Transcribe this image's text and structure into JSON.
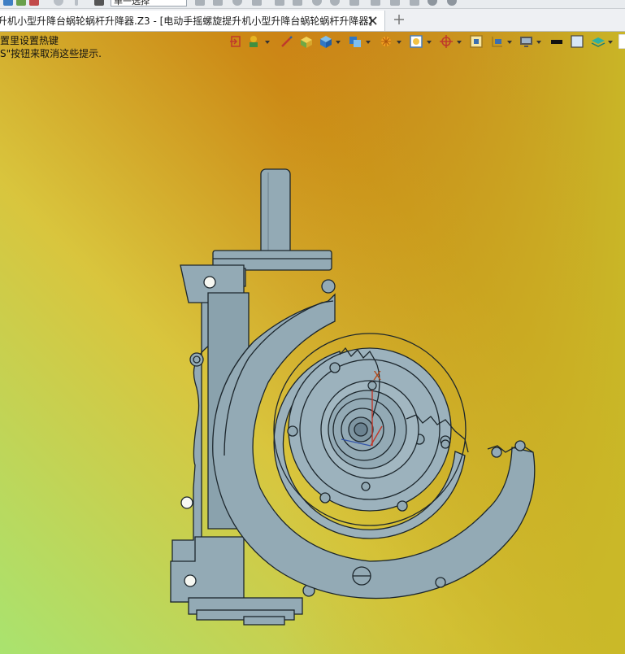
{
  "toolbar": {
    "filter_combo_value": "单一选择"
  },
  "tabs": [
    {
      "label": "升机小型升降台蜗轮蜗杆升降器.Z3 - [电动手摇螺旋提升机小型升降台蜗轮蜗杆升降器]"
    }
  ],
  "viewport": {
    "hint_line1": "置里设置热键",
    "hint_line2": "S\"按钮来取消这些提示.",
    "axis_label": "X",
    "background_colors": [
      "#c95a12",
      "#d9c53d",
      "#a9e36f"
    ],
    "model_color": "#93aab5"
  },
  "view_toolbar": {
    "icons": [
      "exit-sketch-icon",
      "render-mode-icon",
      "pen-icon",
      "shaded-box-icon",
      "cube-view-icon",
      "display-box-icon",
      "sun-light-icon",
      "image-view-icon",
      "axis-triad-icon",
      "grid-icon",
      "section-plane-icon",
      "monitor-icon",
      "line-color-icon",
      "face-color-icon",
      "layers-icon"
    ]
  }
}
